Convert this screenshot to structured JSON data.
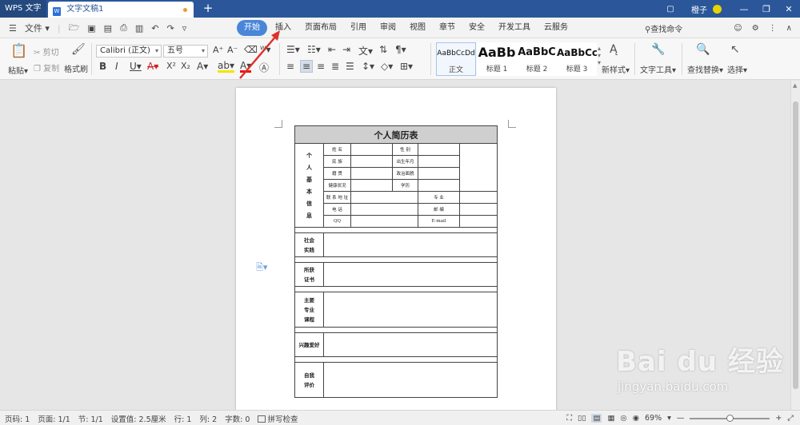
{
  "titlebar": {
    "app_name": "WPS 文字",
    "doc_icon": "W",
    "doc_tab": "文字文稿1",
    "new_tab": "+",
    "user_name": "橙子",
    "minimize": "—",
    "restore": "❐",
    "close": "✕"
  },
  "menubar": {
    "file_menu": "文件",
    "tabs": [
      "开始",
      "插入",
      "页面布局",
      "引用",
      "审阅",
      "视图",
      "章节",
      "安全",
      "开发工具",
      "云服务"
    ],
    "active_tab": "开始",
    "search_command": "查找命令"
  },
  "ribbon": {
    "paste": "粘贴",
    "cut": "剪切",
    "copy": "复制",
    "format_painter": "格式刷",
    "font_name": "Calibri (正文)",
    "font_size": "五号",
    "styles": [
      {
        "sample": "AaBbCcDd",
        "label": "正文"
      },
      {
        "sample": "AaBb",
        "label": "标题 1"
      },
      {
        "sample": "AaBbC",
        "label": "标题 2"
      },
      {
        "sample": "AaBbCc",
        "label": "标题 3"
      }
    ],
    "new_style": "新样式",
    "text_tools": "文字工具",
    "find_replace": "查找替换",
    "select": "选择"
  },
  "resume": {
    "title": "个人简历表",
    "section_personal": "个人基本信息",
    "section_personal_chars": [
      "个",
      "人",
      "基",
      "本",
      "信",
      "息"
    ],
    "fields": {
      "name": "姓 名",
      "gender": "性 别",
      "ethnicity": "民 族",
      "birth": "出生年月",
      "origin": "籍 贯",
      "politics": "政治面貌",
      "health": "健康状况",
      "education": "学历",
      "address": "联 系 地 址",
      "major": "专 业",
      "phone": "电 话",
      "postcode": "邮 编",
      "qq": "QQ",
      "email": "E-mail"
    },
    "social_practice": [
      "社会",
      "实践"
    ],
    "certificates": [
      "所获",
      "证书"
    ],
    "courses": [
      "主要",
      "专业",
      "课程"
    ],
    "hobbies": "兴趣爱好",
    "self_evaluation": [
      "自我",
      "评价"
    ]
  },
  "statusbar": {
    "page_num": "页码: 1",
    "pages": "页面: 1/1",
    "section": "节: 1/1",
    "setting": "设置值: 2.5厘米",
    "row": "行: 1",
    "col": "列: 2",
    "word_count": "字数: 0",
    "spell_check": "拼写检查",
    "zoom": "69%",
    "zoom_level": 0.69,
    "zoom_minus": "—",
    "zoom_plus": "+"
  },
  "watermark": {
    "logo": "Bai du 经验",
    "url": "jingyan.baidu.com"
  },
  "colors": {
    "titlebar": "#2b579a",
    "active_tab": "#4a86d8",
    "annotation_arrow": "#e0302a"
  }
}
